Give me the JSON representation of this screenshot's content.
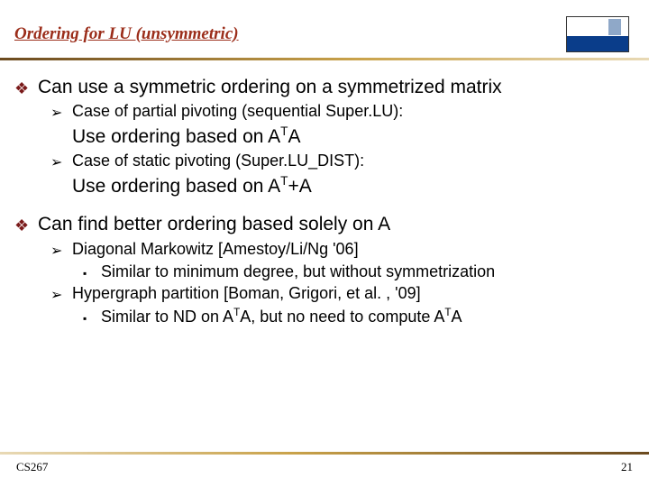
{
  "header": {
    "title": "Ordering for LU (unsymmetric)"
  },
  "p1": {
    "text": "Can use a symmetric ordering on a symmetrized matrix",
    "s1": {
      "label": "Case of partial pivoting (sequential Super.LU):",
      "line_pre": "Use ordering based on A",
      "line_sup": "T",
      "line_post": "A"
    },
    "s2": {
      "label": "Case of static pivoting (Super.LU_DIST):",
      "line_pre": "Use ordering based on A",
      "line_sup": "T",
      "line_post": "+A"
    }
  },
  "p2": {
    "text": "Can find better ordering based solely on A",
    "s1": {
      "label": "Diagonal Markowitz   [Amestoy/Li/Ng '06]",
      "sub": "Similar to minimum degree, but without symmetrization"
    },
    "s2": {
      "label": "Hypergraph partition   [Boman, Grigori, et al. , '09]",
      "sub_pre": "Similar to ND on A",
      "sub_sup1": "T",
      "sub_mid": "A, but no need to compute A",
      "sub_sup2": "T",
      "sub_post": "A"
    }
  },
  "footer": {
    "course": "CS267",
    "page": "21"
  }
}
